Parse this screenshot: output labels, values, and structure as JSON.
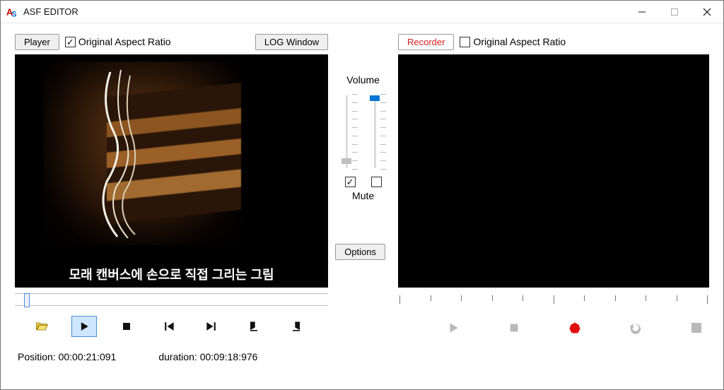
{
  "window": {
    "title": "ASF EDITOR"
  },
  "player": {
    "button_label": "Player",
    "aspect_checked": true,
    "aspect_label": "Original Aspect Ratio",
    "log_button_label": "LOG Window",
    "caption": "모래 캔버스에 손으로 직접 그리는 그림",
    "position_label": "Position:",
    "position_value": "00:00:21:091",
    "duration_label": "duration:",
    "duration_value": "00:09:18:976",
    "slider_fraction": 0.038
  },
  "volume": {
    "label": "Volume",
    "mute_label": "Mute",
    "left_slider_fraction": 0.95,
    "right_slider_fraction": 0.1,
    "left_checked": true,
    "right_checked": false
  },
  "options": {
    "button_label": "Options"
  },
  "recorder": {
    "button_label": "Recorder",
    "aspect_checked": false,
    "aspect_label": "Original Aspect Ratio"
  }
}
